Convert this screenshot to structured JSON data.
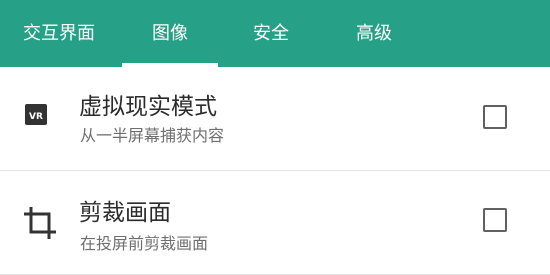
{
  "colors": {
    "tab_bar": "#26a086",
    "tab_text": "#ffffff",
    "title_text": "#2b2b2b",
    "summary_text": "#6f6f6f",
    "checkbox_border": "#616161"
  },
  "tabs": [
    {
      "label": "交互界面",
      "selected": false
    },
    {
      "label": "图像",
      "selected": true
    },
    {
      "label": "安全",
      "selected": false
    },
    {
      "label": "高级",
      "selected": false
    }
  ],
  "settings": [
    {
      "icon": "vr-icon",
      "icon_text": "VR",
      "title": "虚拟现实模式",
      "summary": "从一半屏幕捕获内容",
      "checked": false
    },
    {
      "icon": "crop-icon",
      "title": "剪裁画面",
      "summary": "在投屏前剪裁画面",
      "checked": false
    }
  ]
}
